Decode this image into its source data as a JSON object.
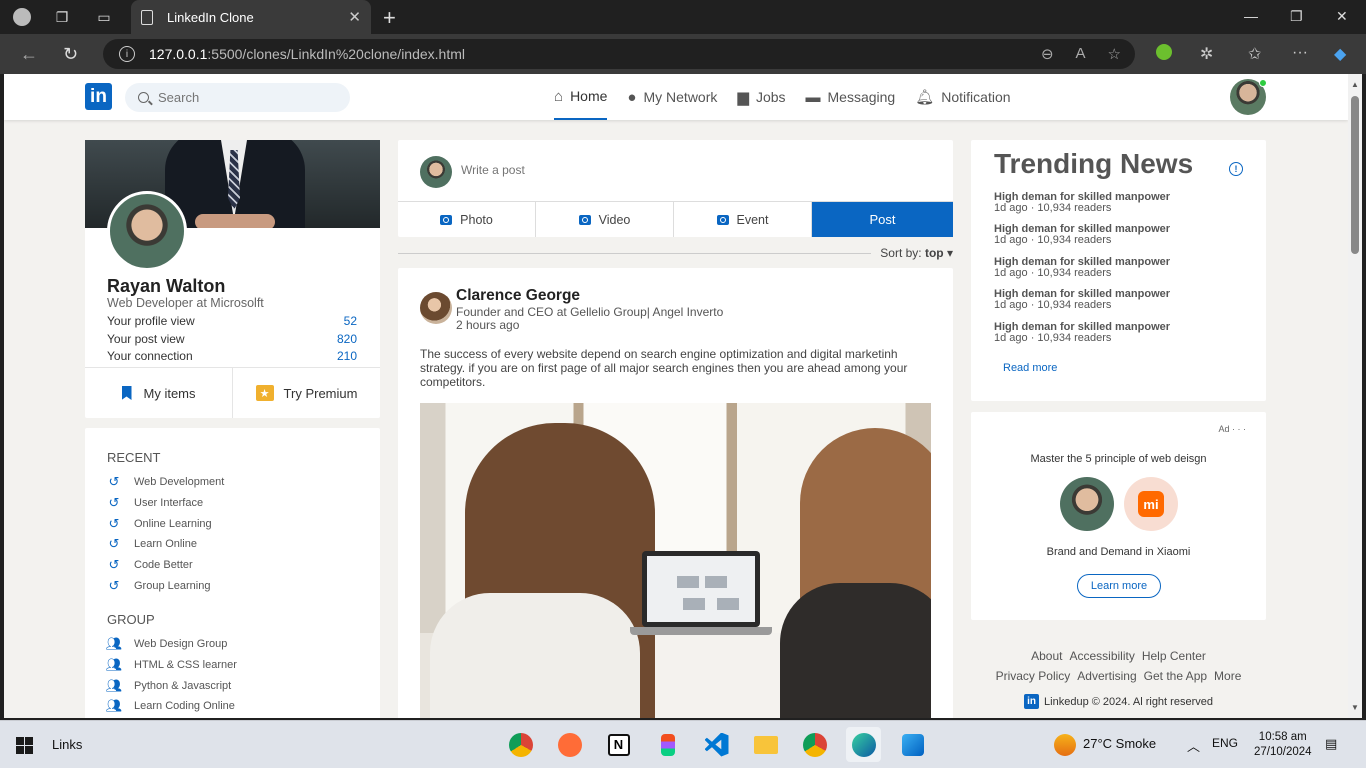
{
  "browser": {
    "tab_title": "LinkedIn Clone",
    "url_host": "127.0.0.1",
    "url_path": ":5500/clones/LinkdIn%20clone/index.html"
  },
  "header": {
    "logo": "in",
    "search_placeholder": "Search",
    "nav": [
      {
        "label": "Home",
        "icon": "home-icon"
      },
      {
        "label": "My Network",
        "icon": "person-icon"
      },
      {
        "label": "Jobs",
        "icon": "briefcase-icon"
      },
      {
        "label": "Messaging",
        "icon": "chat-icon"
      },
      {
        "label": "Notification",
        "icon": "bell-icon"
      }
    ]
  },
  "profile": {
    "name": "Rayan Walton",
    "role": "Web Developer at Microsolft",
    "stats": [
      {
        "label": "Your profile view",
        "value": "52"
      },
      {
        "label": "Your post view",
        "value": "820"
      },
      {
        "label": "Your connection",
        "value": "210"
      }
    ],
    "my_items": "My items",
    "premium": "Try Premium"
  },
  "sidebar": {
    "recent_title": "RECENT",
    "recent": [
      "Web Development",
      "User Interface",
      "Online Learning",
      "Learn Online",
      "Code Better",
      "Group Learning"
    ],
    "group_title": "GROUP",
    "groups": [
      "Web Design Group",
      "HTML & CSS learner",
      "Python & Javascript",
      "Learn Coding Online"
    ]
  },
  "compose": {
    "placeholder": "Write a post",
    "photo": "Photo",
    "video": "Video",
    "event": "Event",
    "post": "Post"
  },
  "sort": {
    "label": "Sort by:",
    "value": "top"
  },
  "post": {
    "author": "Clarence George",
    "headline": "Founder and CEO at Gellelio Group| Angel Inverto",
    "time": "2 hours ago",
    "text": "The success of every website depend on search engine optimization and digital marketinh strategy. if you are on first page of all major search engines then you are ahead among your competitors."
  },
  "trending": {
    "title": "Trending News",
    "items": [
      {
        "headline": "High deman for skilled manpower",
        "meta": "1d ago · 10,934 readers"
      },
      {
        "headline": "High deman for skilled manpower",
        "meta": "1d ago · 10,934 readers"
      },
      {
        "headline": "High deman for skilled manpower",
        "meta": "1d ago · 10,934 readers"
      },
      {
        "headline": "High deman for skilled manpower",
        "meta": "1d ago · 10,934 readers"
      },
      {
        "headline": "High deman for skilled manpower",
        "meta": "1d ago · 10,934 readers"
      }
    ],
    "read_more": "Read more"
  },
  "ad": {
    "label": "Ad · · ·",
    "headline": "Master the 5 principle of web deisgn",
    "brand_logo": "mi",
    "caption": "Brand and Demand in Xiaomi",
    "button": "Learn more"
  },
  "footer": {
    "row1": [
      "About",
      "Accessibility",
      "Help Center"
    ],
    "row2": [
      "Privacy Policy",
      "Advertising",
      "Get the App",
      "More"
    ],
    "copyright": "Linkedup © 2024. Al right reserved"
  },
  "taskbar": {
    "links": "Links",
    "weather": "27°C  Smoke",
    "lang": "ENG",
    "time": "10:58 am",
    "date": "27/10/2024"
  },
  "colors": {
    "accent": "#0a66c2",
    "background": "#f3f2ef"
  }
}
